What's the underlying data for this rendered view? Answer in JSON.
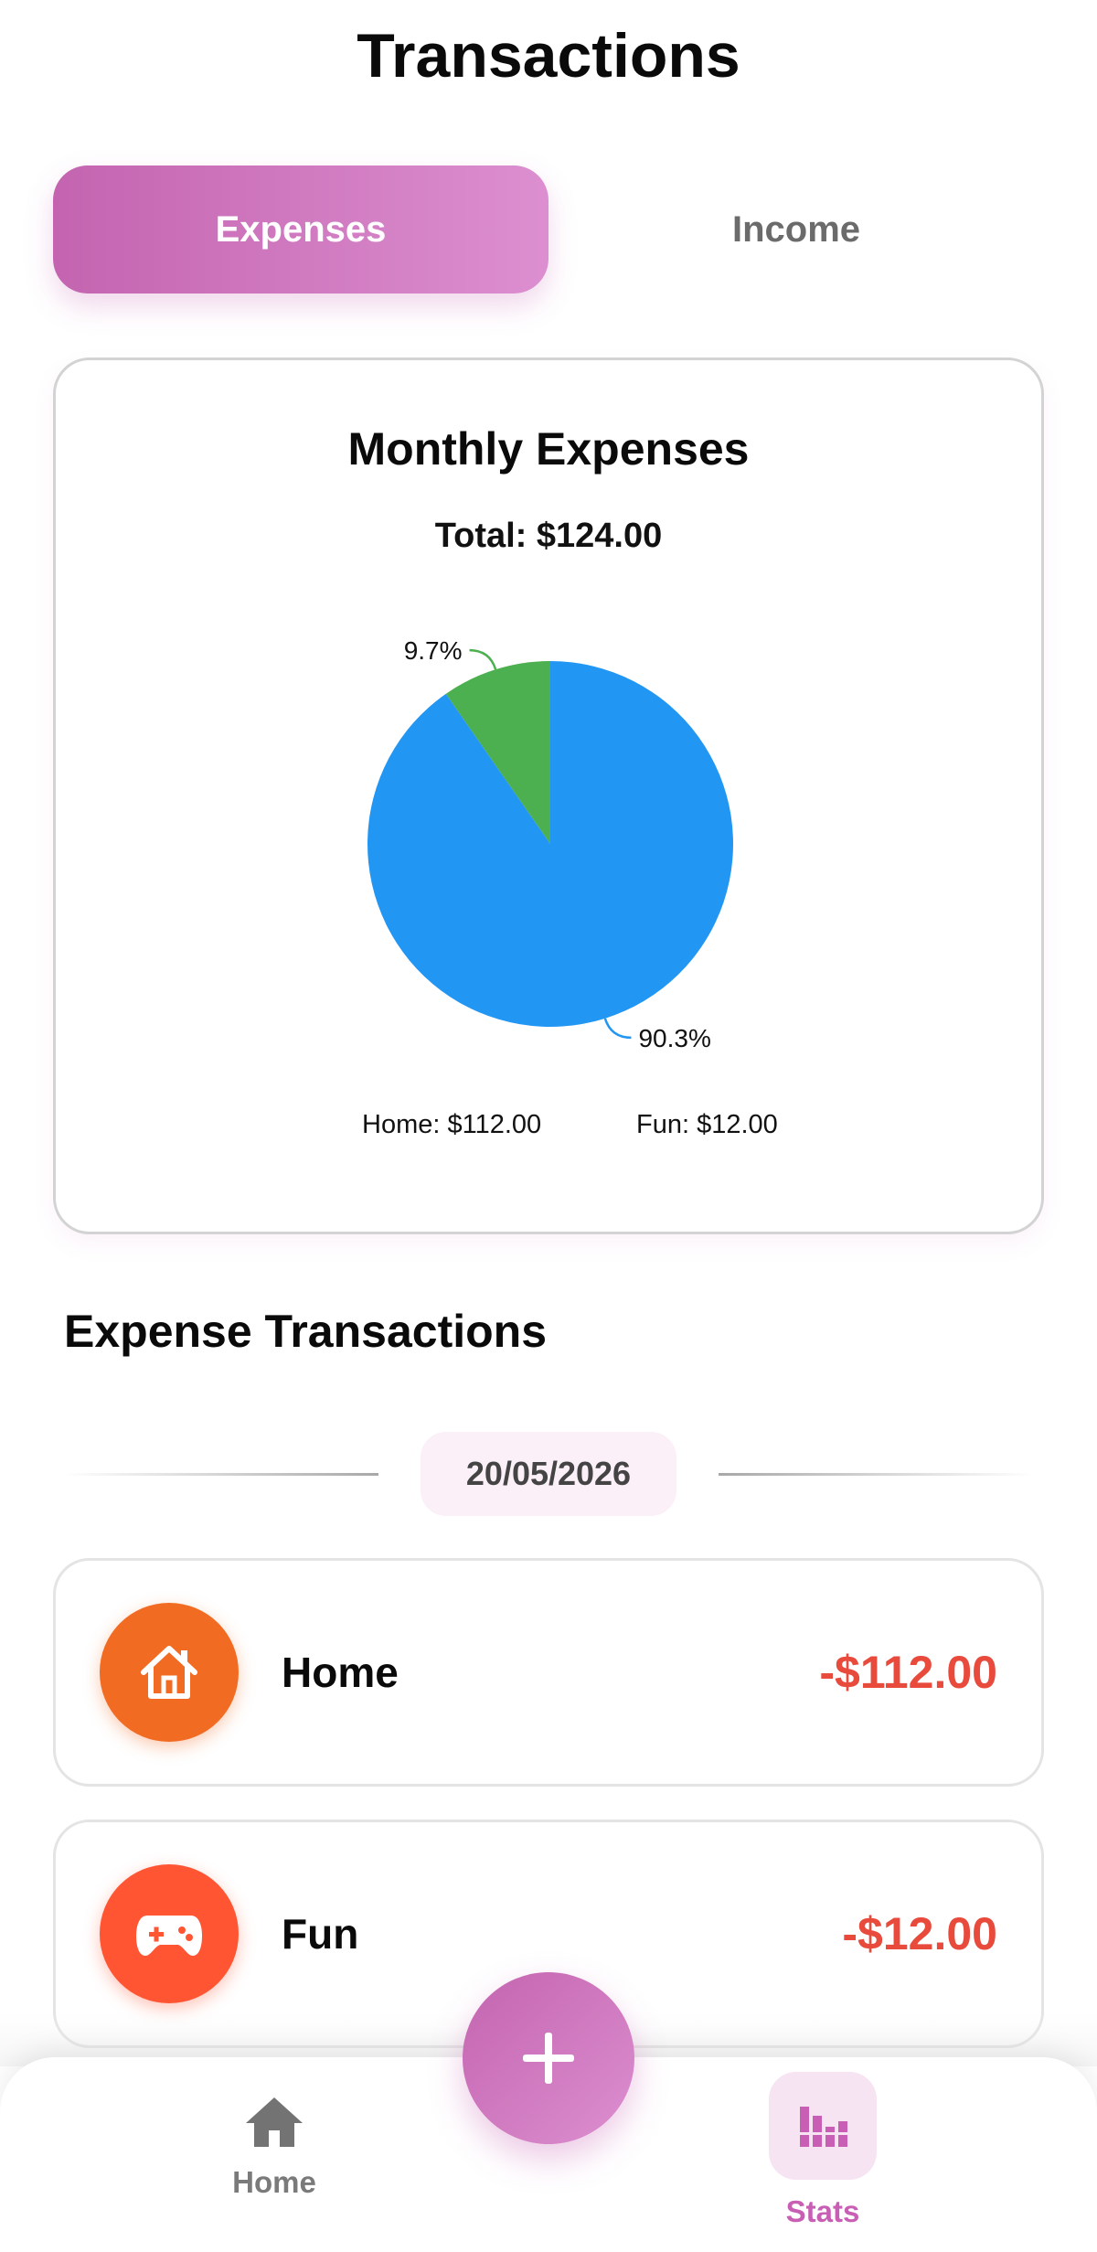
{
  "header": {
    "title": "Transactions"
  },
  "segmented": {
    "active_label": "Expenses",
    "inactive_label": "Income"
  },
  "chart_card": {
    "title": "Monthly Expenses",
    "total": "Total: $124.00"
  },
  "chart_data": {
    "type": "pie",
    "title": "Monthly Expenses",
    "slices": [
      {
        "name": "Home",
        "value": 112.0,
        "percent_label": "90.3%",
        "color": "#2196f3",
        "legend": "Home: $112.00"
      },
      {
        "name": "Fun",
        "value": 12.0,
        "percent_label": "9.7%",
        "color": "#4caf50",
        "legend": "Fun: $12.00"
      }
    ]
  },
  "section": {
    "title": "Expense Transactions"
  },
  "date_group": {
    "date": "20/05/2026"
  },
  "transactions": [
    {
      "name": "Home",
      "amount": "-$112.00",
      "icon": "house-icon",
      "icon_color": "#f26b22"
    },
    {
      "name": "Fun",
      "amount": "-$12.00",
      "icon": "gamepad-icon",
      "icon_color": "#ff5533"
    }
  ],
  "bottom_nav": {
    "items": [
      {
        "label": "Home",
        "icon": "home-icon",
        "active": false
      },
      {
        "label": "Stats",
        "icon": "stats-icon",
        "active": true
      }
    ],
    "fab_icon": "plus-icon"
  },
  "colors": {
    "accent": "#c85fb5",
    "expense_red": "#e84a3c",
    "date_pill_bg": "#fbeff8"
  }
}
